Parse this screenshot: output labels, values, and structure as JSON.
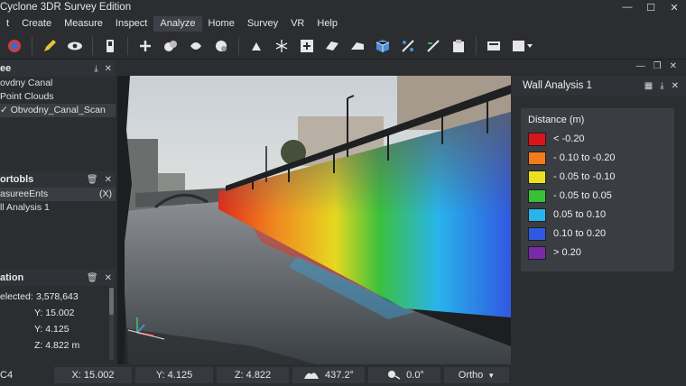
{
  "window": {
    "title": "Cyclone 3DR Survey Edition",
    "controls": {
      "minimize": "—",
      "maximize": "☐",
      "close": "✕"
    }
  },
  "menu": {
    "items": [
      {
        "label": "t",
        "active": false
      },
      {
        "label": "Create",
        "active": false
      },
      {
        "label": "Measure",
        "active": false
      },
      {
        "label": "Inspect",
        "active": false
      },
      {
        "label": "Analyze",
        "active": true
      },
      {
        "label": "Home",
        "active": false
      },
      {
        "label": "Survey",
        "active": false
      },
      {
        "label": "VR",
        "active": false
      },
      {
        "label": "Help",
        "active": false
      }
    ]
  },
  "toolbar": {
    "icons": [
      "globe-icon",
      "eye-icon",
      "device-icon",
      "add-point-icon",
      "cloud-merge-icon",
      "shape-icon",
      "mesh-icon",
      "cloud-segment-icon",
      "brush-icon",
      "axis-icon",
      "add-box-icon",
      "plane-icon",
      "surface-icon",
      "cube-icon",
      "scale-icon",
      "measure-icon",
      "clipboard-icon",
      "layer-icon",
      "render-icon"
    ]
  },
  "tree_panel": {
    "title": "ee",
    "rows": [
      {
        "label": "ovdny Canal",
        "selected": false
      },
      {
        "label": " Point Clouds",
        "selected": false
      },
      {
        "label": "✓ Obvodny_Canal_Scan",
        "selected": true
      }
    ]
  },
  "reports_panel": {
    "title": "ortobls",
    "rows": [
      {
        "label": "asureeEnts",
        "badge": "(X)",
        "selected": true
      },
      {
        "label": "ll Analysis 1",
        "badge": "",
        "selected": false
      }
    ]
  },
  "info_panel": {
    "title": "ation",
    "selected_label": "elected:",
    "selected_value": "3,578,643",
    "y1": "Y: 15.002",
    "y2": "Y: 4.125",
    "z": "Z: 4.822 m"
  },
  "wall_panel": {
    "title": "Wall Analysis 1",
    "legend_title": "Distance (m)",
    "legend": [
      {
        "label": "< -0.20",
        "color": "#d8141c"
      },
      {
        "label": "- 0.10 to -0.20",
        "color": "#f07c1c"
      },
      {
        "label": "- 0.05 to -0.10",
        "color": "#e8e020"
      },
      {
        "label": "- 0.05 to 0.05",
        "color": "#38c038"
      },
      {
        "label": "0.05 to 0.10",
        "color": "#28b4ec"
      },
      {
        "label": "0.10 to 0.20",
        "color": "#3058e0"
      },
      {
        "label": "> 0.20",
        "color": "#7a2aa8"
      }
    ]
  },
  "statusbar": {
    "c4": "C4",
    "x": "X: 15.002",
    "y": "Y: 4.125",
    "z": "Z: 4.822",
    "angle1": "437.2°",
    "angle2": "0.0°",
    "projection": "Ortho"
  }
}
